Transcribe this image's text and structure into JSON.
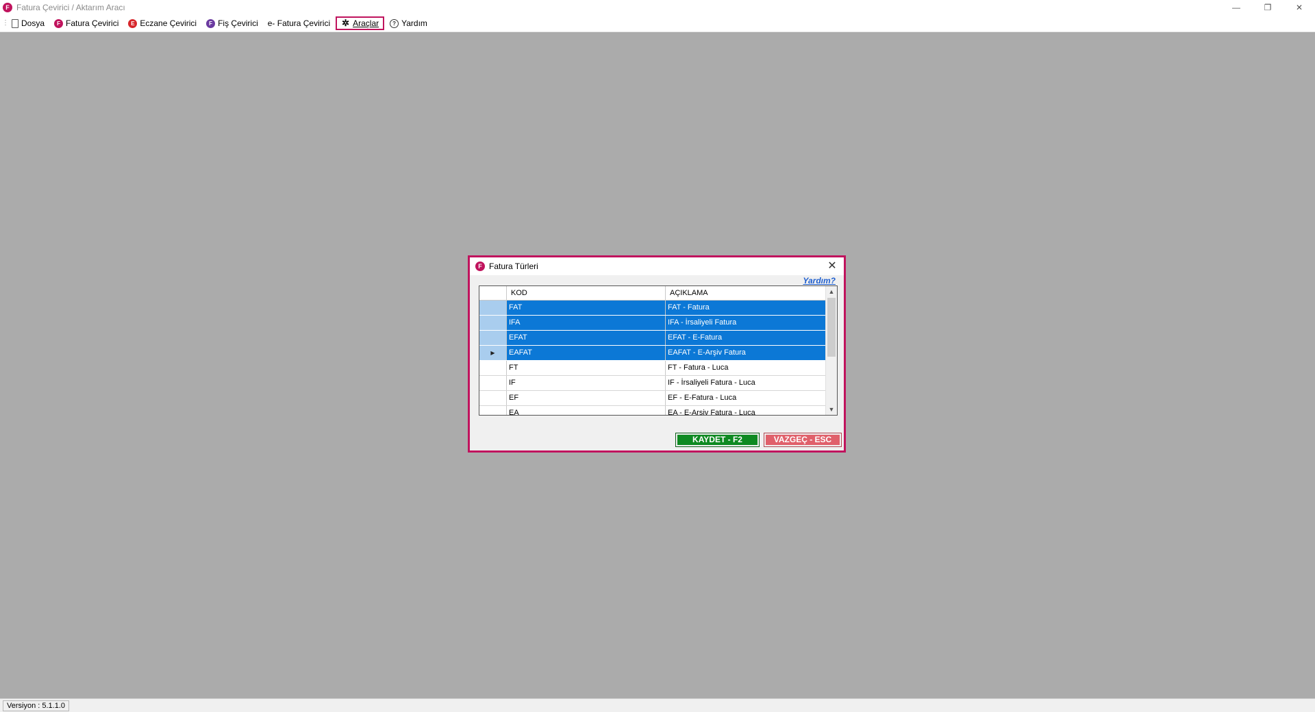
{
  "window": {
    "title": "Fatura Çevirici / Aktarım Aracı",
    "logo_letter": "F",
    "controls": {
      "minimize": "—",
      "restore": "❐",
      "close": "✕"
    }
  },
  "menu": {
    "items": [
      {
        "label": "Dosya",
        "icon": "document-icon"
      },
      {
        "label": "Fatura Çevirici",
        "icon": "fatura-f-icon"
      },
      {
        "label": "Eczane Çevirici",
        "icon": "eczane-e-icon"
      },
      {
        "label": "Fiş Çevirici",
        "icon": "fis-f-icon"
      },
      {
        "label": "e- Fatura Çevirici",
        "icon": "e-fatura-icon"
      },
      {
        "label": "Araçlar",
        "icon": "tools-icon"
      },
      {
        "label": "Yardım",
        "icon": "help-icon"
      }
    ]
  },
  "dialog": {
    "title": "Fatura Türleri",
    "logo_letter": "F",
    "help_link": "Yardım?",
    "grid": {
      "headers": {
        "kod": "KOD",
        "aciklama": "AÇIKLAMA"
      },
      "rows": [
        {
          "kod": "FAT",
          "aciklama": "FAT - Fatura",
          "selected": true
        },
        {
          "kod": "IFA",
          "aciklama": "IFA - İrsaliyeli Fatura",
          "selected": true
        },
        {
          "kod": "EFAT",
          "aciklama": "EFAT - E-Fatura",
          "selected": true
        },
        {
          "kod": "EAFAT",
          "aciklama": "EAFAT - E-Arşiv Fatura",
          "selected": true,
          "current": true
        },
        {
          "kod": "FT",
          "aciklama": "FT - Fatura - Luca",
          "selected": false
        },
        {
          "kod": "IF",
          "aciklama": "IF - İrsaliyeli Fatura - Luca",
          "selected": false
        },
        {
          "kod": "EF",
          "aciklama": "EF - E-Fatura - Luca",
          "selected": false
        },
        {
          "kod": "EA",
          "aciklama": "EA - E-Arşiv Fatura - Luca",
          "selected": false
        }
      ]
    },
    "buttons": {
      "save": "KAYDET - F2",
      "cancel": "VAZGEÇ - ESC"
    }
  },
  "status": {
    "version": "Versiyon : 5.1.1.0"
  },
  "colors": {
    "accent": "#c0135d",
    "selection": "#0c78d6",
    "save": "#0e8a22",
    "cancel": "#e0606b",
    "workspace": "#ababab"
  }
}
